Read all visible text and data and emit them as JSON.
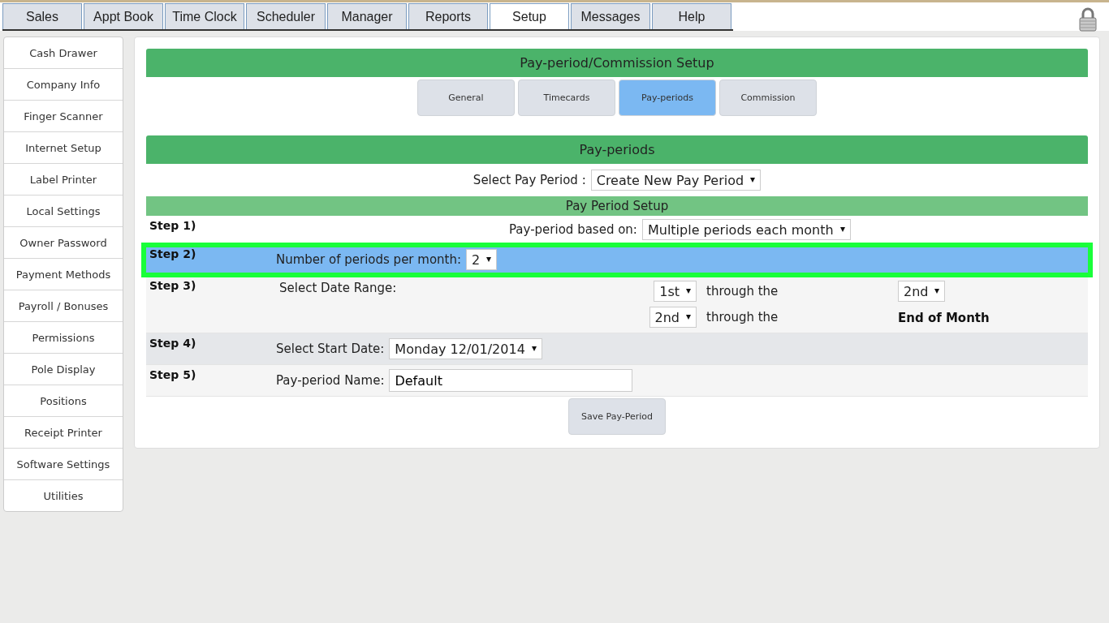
{
  "top_tabs": [
    {
      "label": "Sales",
      "selected": false
    },
    {
      "label": "Appt Book",
      "selected": false
    },
    {
      "label": "Time Clock",
      "selected": false
    },
    {
      "label": "Scheduler",
      "selected": false
    },
    {
      "label": "Manager",
      "selected": false
    },
    {
      "label": "Reports",
      "selected": false
    },
    {
      "label": "Setup",
      "selected": true
    },
    {
      "label": "Messages",
      "selected": false
    },
    {
      "label": "Help",
      "selected": false
    }
  ],
  "sidebar": {
    "items": [
      {
        "label": "Cash Drawer"
      },
      {
        "label": "Company Info"
      },
      {
        "label": "Finger Scanner"
      },
      {
        "label": "Internet Setup"
      },
      {
        "label": "Label Printer"
      },
      {
        "label": "Local Settings"
      },
      {
        "label": "Owner Password"
      },
      {
        "label": "Payment Methods"
      },
      {
        "label": "Payroll / Bonuses"
      },
      {
        "label": "Permissions"
      },
      {
        "label": "Pole Display"
      },
      {
        "label": "Positions"
      },
      {
        "label": "Receipt Printer"
      },
      {
        "label": "Software Settings"
      },
      {
        "label": "Utilities"
      }
    ]
  },
  "panel": {
    "title": "Pay-period/Commission Setup",
    "subtabs": [
      {
        "label": "General",
        "selected": false
      },
      {
        "label": "Timecards",
        "selected": false
      },
      {
        "label": "Pay-periods",
        "selected": true
      },
      {
        "label": "Commission",
        "selected": false
      }
    ],
    "section_title": "Pay-periods",
    "select_pay_period": {
      "label": "Select Pay Period :",
      "value": "Create New Pay Period"
    },
    "setup_title": "Pay Period Setup",
    "steps": [
      {
        "step": "Step 1)",
        "kind": "centered-select",
        "highlighted": false,
        "label": "Pay-period based on:",
        "value": "Multiple periods each month"
      },
      {
        "step": "Step 2)",
        "kind": "select",
        "highlighted": true,
        "label": "Number of periods per month:",
        "value": "2"
      },
      {
        "step": "Step 3)",
        "kind": "date-range",
        "highlighted": false,
        "label": "Select Date Range:",
        "ranges": [
          {
            "from": "1st",
            "through": "through the",
            "to": {
              "kind": "select",
              "value": "2nd"
            }
          },
          {
            "from": "2nd",
            "through": "through the",
            "to": {
              "kind": "text",
              "value": "End of Month"
            }
          }
        ]
      },
      {
        "step": "Step 4)",
        "kind": "select",
        "highlighted": false,
        "label": "Select Start Date:",
        "value": "Monday 12/01/2014"
      },
      {
        "step": "Step 5)",
        "kind": "text",
        "highlighted": false,
        "label": "Pay-period Name:",
        "value": "Default"
      }
    ],
    "save_button": "Save Pay-Period"
  }
}
